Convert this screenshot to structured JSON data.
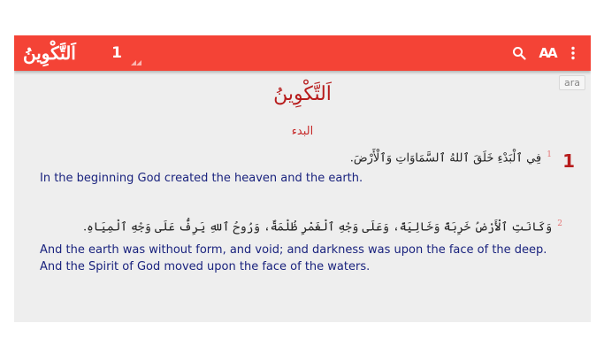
{
  "toolbar": {
    "book": "اَلتَّكْوِينُ",
    "chapter": "1",
    "icons": [
      "search-icon",
      "text-size-icon",
      "more-vertical-icon"
    ],
    "text_size_label": "AA"
  },
  "language_tag": "ara",
  "content": {
    "book_title": "اَلتَّكْوِينُ",
    "section_heading": "البدء",
    "chapter_number": "1",
    "verses": [
      {
        "number": "1",
        "arabic": "فِي ٱلْبَدْءِ خَلَقَ ٱللهُ ٱلسَّمَاوَاتِ وَٱلْأَرْضَ.",
        "english": [
          "In the beginning God created the heaven and the earth."
        ]
      },
      {
        "number": "2",
        "arabic": "وَكَانَتِ ٱلْأَرْضُ خَرِبَةً وَخَالِيَةً، وَعَلَى وَجْهِ ٱلْغَمْرِ ظُلْمَةٌ، وَرُوحُ ٱللهِ يَرِفُّ عَلَى وَجْهِ ٱلْمِيَاهِ.",
        "english": [
          "And the earth was without form, and void; and darkness was upon the face of the deep.",
          "And the Spirit of God moved upon the face of the waters."
        ]
      }
    ]
  },
  "colors": {
    "toolbar": "#f44336",
    "title_red": "#b71c1c",
    "english_text": "#1a237e",
    "background": "#eeeeee"
  }
}
